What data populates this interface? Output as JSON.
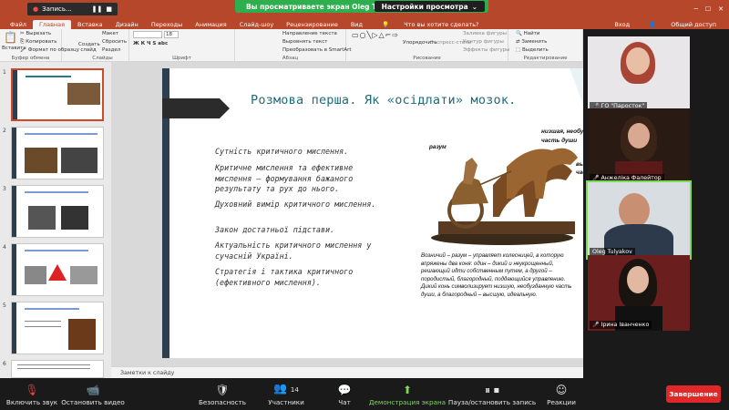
{
  "app": {
    "recording_title": "Запись...",
    "share_banner": "Вы просматриваете экран Oleg Tulyakov",
    "view_options": "Настройки просмотра"
  },
  "ribbon": {
    "tabs": [
      "Файл",
      "Главная",
      "Вставка",
      "Дизайн",
      "Переходы",
      "Анимация",
      "Слайд-шоу",
      "Рецензирование",
      "Вид"
    ],
    "active_tab": "Главная",
    "tell_me": "Что вы хотите сделать?",
    "sign_in": "Вход",
    "share": "Общий доступ",
    "groups": {
      "clipboard": {
        "label": "Буфер обмена",
        "paste": "Вставить",
        "cut": "Вырезать",
        "copy": "Копировать",
        "format": "Формат по образцу"
      },
      "slides": {
        "label": "Слайды",
        "create": "Создать слайд",
        "layout": "Макет",
        "reset": "Сбросить",
        "section": "Раздел"
      },
      "font": {
        "label": "Шрифт",
        "size": "18"
      },
      "paragraph": {
        "label": "Абзац",
        "direction": "Направление текста",
        "align": "Выровнять текст",
        "smartart": "Преобразовать в SmartArt"
      },
      "drawing": {
        "label": "Рисование",
        "arrange": "Упорядочить",
        "styles": "Экспресс-стили",
        "fill": "Заливка фигуры",
        "outline": "Контур фигуры",
        "effects": "Эффекты фигуры"
      },
      "editing": {
        "label": "Редактирование",
        "find": "Найти",
        "replace": "Заменить",
        "select": "Выделить"
      }
    }
  },
  "slides_panel": {
    "numbers": [
      "1",
      "2",
      "3",
      "4",
      "5",
      "6"
    ],
    "selected": 1
  },
  "slide": {
    "title": "Розмова перша. Як «осідлати» мозок.",
    "bullets": [
      "Сутність критичного мислення.",
      "Критичне мислення та ефективне мислення – формування бажаного результату та рух до нього.",
      "Духовний вимір критичного мислення.",
      "Закон достатньої підстави.",
      "Актуальність критичного мислення у сучасній Україні.",
      "Стратегія і тактика критичного (ефективного мислення)."
    ],
    "image_labels": {
      "razum": "разум",
      "nizshaya": "низшая, необу",
      "chast_dushi": "часть души",
      "vy": "вы",
      "cha": "час"
    },
    "caption": "Возничий – разум – управляет колесницей, в которую впряжены два коня: один – дикий и неукрощенный, решающий идти собственным путем, а другой – породистый, благородный, поддающийся управлению. Дикий конь символизирует низшую, необузданную часть души, а благородный – высшую, идеальную."
  },
  "notes": {
    "placeholder": "Заметки к слайду"
  },
  "participants": [
    {
      "name": "ГО \"Паросток\"",
      "muted": true
    },
    {
      "name": "Анжеліка Фалейтор",
      "muted": true
    },
    {
      "name": "Oleg Tulyakov",
      "muted": false,
      "active": true
    },
    {
      "name": "Ірина Іванченко",
      "muted": true
    }
  ],
  "toolbar": {
    "unmute": "Включить звук",
    "video": "Остановить видео",
    "security": "Безопасность",
    "participants": "Участники",
    "participants_count": "14",
    "chat": "Чат",
    "share": "Демонстрация экрана",
    "record": "Пауза/остановить запись",
    "reactions": "Реакции",
    "end": "Завершение"
  },
  "colors": {
    "pp_red": "#b7472a",
    "zoom_green": "#2fae4f",
    "slide_title": "#1f6b7a",
    "end_red": "#e02828",
    "share_green": "#7ed957"
  }
}
